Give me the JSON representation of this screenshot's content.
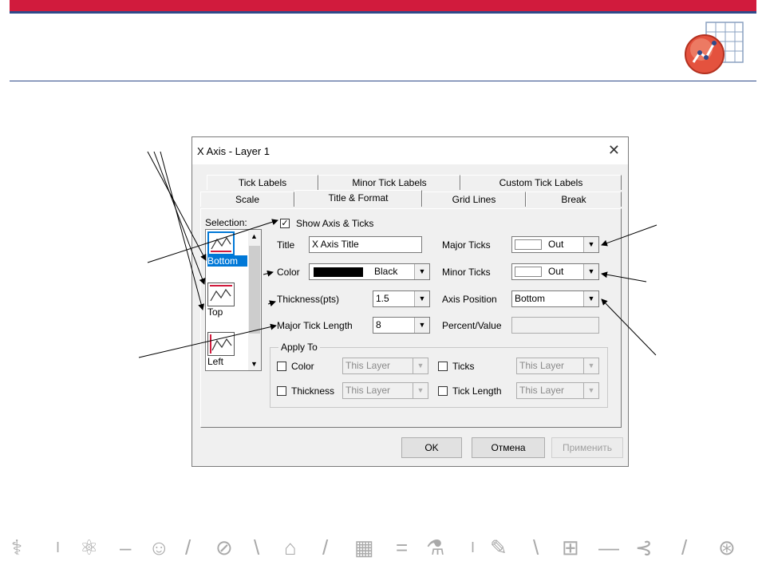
{
  "dialog": {
    "title": "X Axis - Layer 1",
    "close_glyph": "✕",
    "tabs_row1": [
      "Tick Labels",
      "Minor Tick Labels",
      "Custom Tick Labels"
    ],
    "tabs_row2": [
      "Scale",
      "Title & Format",
      "Grid Lines",
      "Break"
    ],
    "active_tab": "Title & Format",
    "selection_label": "Selection:",
    "selection_items": [
      "Bottom",
      "Top",
      "Left"
    ],
    "selected_item": "Bottom",
    "show_axis_label": "Show Axis & Ticks",
    "show_axis_checked": true,
    "title_label": "Title",
    "title_value": "X Axis Title",
    "color_label": "Color",
    "color_value": "Black",
    "thickness_label": "Thickness(pts)",
    "thickness_value": "1.5",
    "major_tick_length_label": "Major Tick Length",
    "major_tick_length_value": "8",
    "major_ticks_label": "Major Ticks",
    "major_ticks_value": "Out",
    "minor_ticks_label": "Minor Ticks",
    "minor_ticks_value": "Out",
    "axis_position_label": "Axis Position",
    "axis_position_value": "Bottom",
    "percent_value_label": "Percent/Value",
    "percent_value_value": "",
    "apply_to_label": "Apply To",
    "apply_color_label": "Color",
    "apply_ticks_label": "Ticks",
    "apply_thickness_label": "Thickness",
    "apply_tick_length_label": "Tick Length",
    "apply_scope_value": "This Layer",
    "ok_label": "OK",
    "cancel_label": "Отмена",
    "apply_label": "Применить"
  },
  "colors": {
    "accent_red": "#d11b3d",
    "accent_blue": "#2f4a8a",
    "selection_blue": "#0078d7"
  },
  "logo_icon": "origin-graph-icon",
  "footer_icons": [
    "dna-icon",
    "atom-icon",
    "lightbulb-head-icon",
    "compass-icon",
    "puzzle-icon",
    "chart-icon",
    "flask-icon",
    "document-pen-icon",
    "book-icon",
    "network-icon",
    "globe-icon"
  ]
}
